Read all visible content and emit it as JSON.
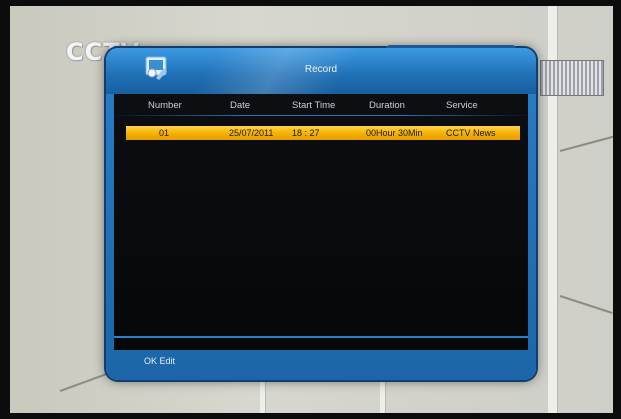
{
  "logo": {
    "text": "CCTV"
  },
  "dialog": {
    "title": "Record",
    "icon": "record-app-icon",
    "columns": [
      "Number",
      "Date",
      "Start Time",
      "Duration",
      "Service"
    ],
    "rows": [
      {
        "number": "01",
        "date": "25/07/2011",
        "start_time": "18 : 27",
        "duration": "00Hour 30Min",
        "service": "CCTV News"
      }
    ],
    "selected_row": 0,
    "footer_hint": "OK Edit"
  },
  "colors": {
    "dialog_blue": "#2a7ec6",
    "list_background": "#0c0e12",
    "selection_yellow": "#f4b000",
    "header_text": "#c7d2df"
  }
}
